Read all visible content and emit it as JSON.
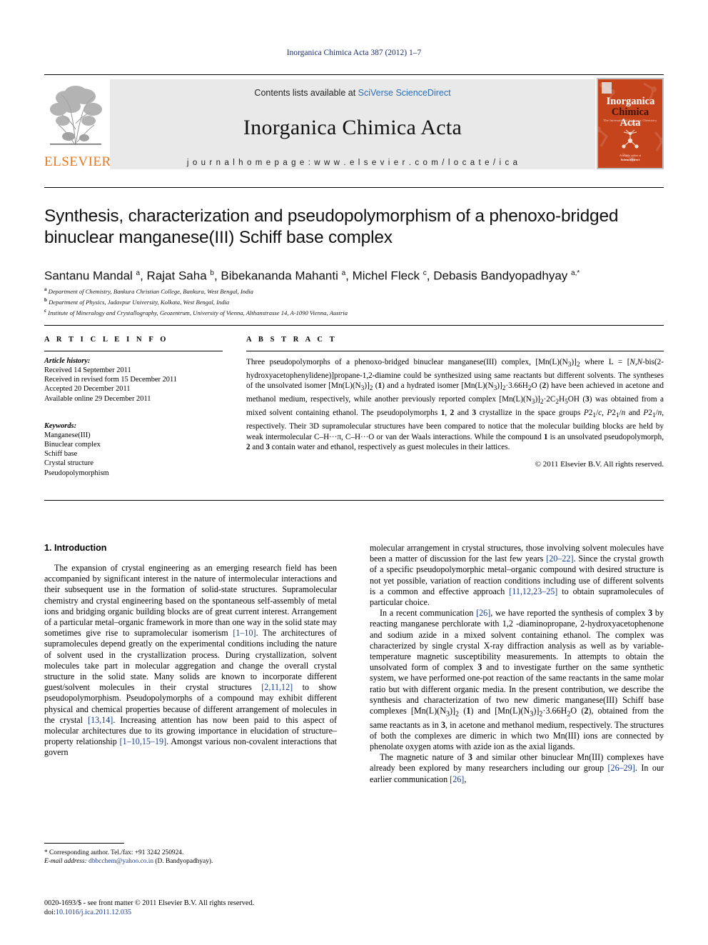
{
  "running_head": "Inorganica Chimica Acta 387 (2012) 1–7",
  "masthead": {
    "publisher": "ELSEVIER",
    "contents_prefix": "Contents lists available at ",
    "contents_link": "SciVerse ScienceDirect",
    "journal_title": "Inorganica Chimica Acta",
    "homepage": "j o u r n a l   h o m e p a g e :   w w w . e l s e v i e r . c o m / l o c a t e / i c a",
    "cover": {
      "line1": "Inorganica",
      "line2_a": "Chimica",
      "line2_b": "Acta",
      "subtitle": "The International Inorganic Chemistry Journal",
      "footer_small": "Available online at",
      "footer_brand": "ScienceDirect"
    }
  },
  "article": {
    "title": "Synthesis, characterization and pseudopolymorphism of a phenoxo-bridged binuclear manganese(III) Schiff base complex",
    "authors_html": "Santanu Mandal <sup>a</sup>, Rajat Saha <sup>b</sup>, Bibekananda Mahanti <sup>a</sup>, Michel Fleck <sup>c</sup>, Debasis Bandyopadhyay <sup>a,<span class=\"star\">*</span></sup>",
    "affiliations": [
      {
        "marker": "a",
        "text": "Department of Chemistry, Bankura Christian College, Bankura, West Bengal, India"
      },
      {
        "marker": "b",
        "text": "Department of Physics, Jadavpur University, Kolkata, West Bengal, India"
      },
      {
        "marker": "c",
        "text": "Institute of Mineralogy and Crystallography, Geozentrum, University of Vienna, Althanstrasse 14, A-1090 Vienna, Austria"
      }
    ]
  },
  "article_info": {
    "label": "A R T I C L E    I N F O",
    "history_heading": "Article history:",
    "history": [
      "Received 14 September 2011",
      "Received in revised form 15 December 2011",
      "Accepted 20 December 2011",
      "Available online 29 December 2011"
    ],
    "keywords_heading": "Keywords:",
    "keywords": [
      "Manganese(III)",
      "Binuclear complex",
      "Schiff base",
      "Crystal structure",
      "Pseudopolymorphism"
    ]
  },
  "abstract": {
    "label": "A B S T R A C T",
    "body_html": "Three pseudopolymorphs of a phenoxo-bridged binuclear manganese(III) complex, [Mn(L)(N<sub>3</sub>)]<sub>2</sub> where L = [<i>N,N</i>-bis(2-hydroxyacetophenylidene)]propane-1,2-diamine could be synthesized using same reactants but different solvents. The syntheses of the unsolvated isomer [Mn(L)(N<sub>3</sub>)]<sub>2</sub> (<b>1</b>) and a hydrated isomer [Mn(L)(N<sub>3</sub>)]<sub>2</sub>·3.66H<sub>2</sub>O (<b>2</b>) have been achieved in acetone and methanol medium, respectively, while another previously reported complex [Mn(L)(N<sub>3</sub>)]<sub>2</sub>·2C<sub>2</sub>H<sub>5</sub>OH (<b>3</b>) was obtained from a mixed solvent containing ethanol. The pseudopolymorphs <b>1</b>, <b>2</b> and <b>3</b> crystallize in the space groups <i>P</i>2<sub>1</sub>/<i>c</i>, <i>P</i>2<sub>1</sub>/<i>n</i> and <i>P</i>2<sub>1</sub>/<i>n</i>, respectively. Their 3D supramolecular structures have been compared to notice that the molecular building blocks are held by weak intermolecular C–H···π, C–H···O or van der Waals interactions. While the compound <b>1</b> is an unsolvated pseudopolymorph, <b>2</b> and <b>3</b> contain water and ethanol, respectively as guest molecules in their lattices.",
    "copyright": "© 2011 Elsevier B.V. All rights reserved."
  },
  "intro": {
    "heading": "1. Introduction",
    "left_paragraphs_html": [
      "The expansion of crystal engineering as an emerging research field has been accompanied by significant interest in the nature of intermolecular interactions and their subsequent use in the formation of solid-state structures. Supramolecular chemistry and crystal engineering based on the spontaneous self-assembly of metal ions and bridging organic building blocks are of great current interest. Arrangement of a particular metal–organic framework in more than one way in the solid state may sometimes give rise to supramolecular isomerism <span class=\"ref\">[1–10]</span>. The architectures of supramolecules depend greatly on the experimental conditions including the nature of solvent used in the crystallization process. During crystallization, solvent molecules take part in molecular aggregation and change the overall crystal structure in the solid state. Many solids are known to incorporate different guest/solvent molecules in their crystal structures <span class=\"ref\">[2,11,12]</span> to show pseudopolymorphism. Pseudopolymorphs of a compound may exhibit different physical and chemical properties because of different arrangement of molecules in the crystal <span class=\"ref\">[13,14]</span>. Increasing attention has now been paid to this aspect of molecular architectures due to its growing importance in elucidation of structure–property relationship <span class=\"ref\">[1–10,15–19]</span>. Amongst various non-covalent interactions that govern"
    ],
    "right_paragraphs_html": [
      "molecular arrangement in crystal structures, those involving solvent molecules have been a matter of discussion for the last few years <span class=\"ref\">[20–22]</span>. Since the crystal growth of a specific pseudopolymorphic metal–organic compound with desired structure is not yet possible, variation of reaction conditions including use of different solvents is a common and effective approach <span class=\"ref\">[11,12,23–25]</span> to obtain supramolecules of particular choice.",
      "In a recent communication <span class=\"ref\">[26]</span>, we have reported the synthesis of complex <b>3</b> by reacting manganese perchlorate with 1,2 -diaminopropane, 2-hydroxyacetophenone and sodium azide in a mixed solvent containing ethanol. The complex was characterized by single crystal X-ray diffraction analysis as well as by variable-temperature magnetic susceptibility measurements. In attempts to obtain the unsolvated form of complex <b>3</b> and to investigate further on the same synthetic system, we have performed one-pot reaction of the same reactants in the same molar ratio but with different organic media. In the present contribution, we describe the synthesis and characterization of two new dimeric manganese(III) Schiff base complexes [Mn(L)(N<sub>3</sub>)]<sub>2</sub> (<b>1</b>) and [Mn(L)(N<sub>3</sub>)]<sub>2</sub>·3.66H<sub>2</sub>O (<b>2</b>), obtained from the same reactants as in <b>3</b>, in acetone and methanol medium, respectively. The structures of both the complexes are dimeric in which two Mn(III) ions are connected by phenolate oxygen atoms with azide ion as the axial ligands.",
      "The magnetic nature of <b>3</b> and similar other binuclear Mn(III) complexes have already been explored by many researchers including our group <span class=\"ref\">[26–29]</span>. In our earlier communication <span class=\"ref\">[26]</span>,"
    ]
  },
  "footnote": {
    "corresponding_html": "<span class=\"star\">*</span> Corresponding author. Tel./fax: +91 3242 250924.",
    "email_label": "E-mail address:",
    "email": "dbbcchem@yahoo.co.in",
    "email_person": "(D. Bandyopadhyay)."
  },
  "imprint": {
    "line1": "0020-1693/$ - see front matter © 2011 Elsevier B.V. All rights reserved.",
    "doi_label": "doi:",
    "doi_value": "10.1016/j.ica.2011.12.035"
  },
  "colors": {
    "link_blue": "#1a3d8f",
    "sciencedirect_blue": "#2a6ebb",
    "elsevier_orange": "#E87722",
    "cover_red": "#c6441c",
    "band_gray": "#e9e9e9"
  }
}
